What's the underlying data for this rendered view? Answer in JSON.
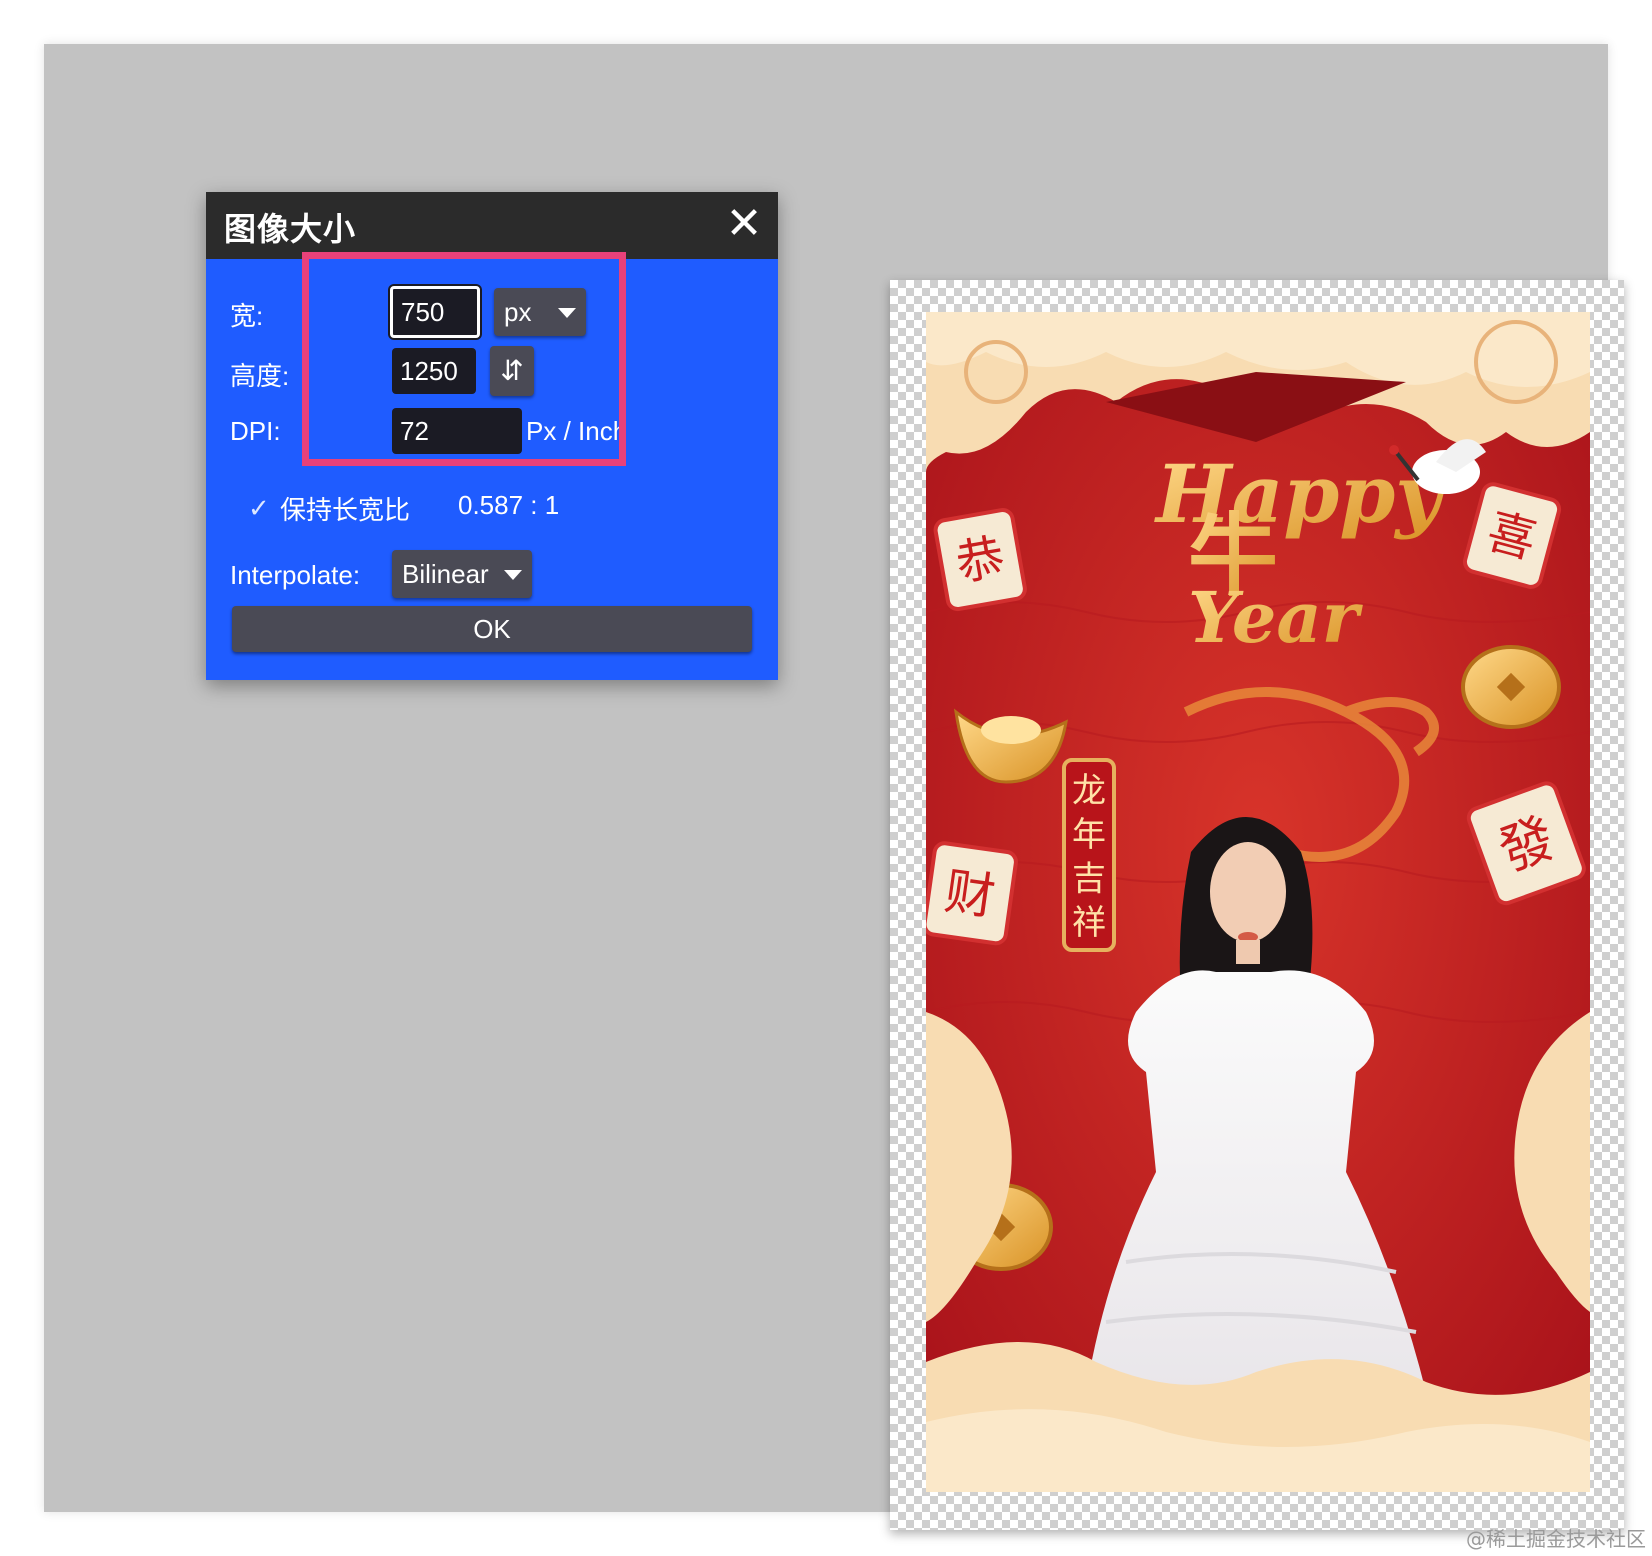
{
  "dialog": {
    "title": "图像大小",
    "close_glyph": "✕",
    "width_label": "宽:",
    "width_value": "750",
    "unit_selected": "px",
    "height_label": "高度:",
    "height_value": "1250",
    "swap_glyph": "⇵",
    "dpi_label": "DPI:",
    "dpi_value": "72",
    "dpi_unit": "Px / Inch",
    "keep_ratio_check": "✓",
    "keep_ratio_label": "保持长宽比",
    "ratio_value": "0.587 : 1",
    "interpolate_label": "Interpolate:",
    "interpolate_selected": "Bilinear",
    "ok_label": "OK"
  },
  "poster": {
    "headline_happy": "Happy",
    "headline_niu": "牛",
    "headline_year": "Year",
    "tile_gong": "恭",
    "tile_xi": "喜",
    "tile_fa": "發",
    "tile_cai": "财",
    "banner_chars": [
      "龙",
      "年",
      "吉",
      "祥"
    ]
  },
  "icons": {
    "close": "close-icon",
    "caret": "chevron-down-icon",
    "swap": "swap-vertical-icon",
    "check": "check-icon"
  },
  "colors": {
    "dialog_bg": "#1f5cff",
    "titlebar_bg": "#2b2b2b",
    "highlight": "#e8417a",
    "poster_red": "#c81e1e",
    "cloud_cream": "#f8dcb2"
  },
  "footer": {
    "watermark": "@稀土掘金技术社区"
  }
}
